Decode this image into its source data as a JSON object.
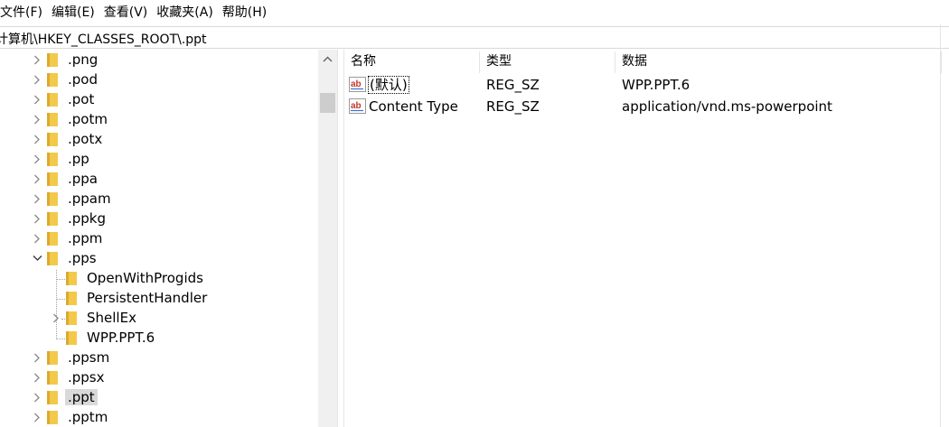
{
  "menu": {
    "file": "文件(F)",
    "edit": "编辑(E)",
    "view": "查看(V)",
    "favorites": "收藏夹(A)",
    "help": "帮助(H)"
  },
  "address": {
    "path": "计算机\\HKEY_CLASSES_ROOT\\.ppt"
  },
  "tree": {
    "items": [
      {
        "label": ".png",
        "state": "collapsed"
      },
      {
        "label": ".pod",
        "state": "collapsed"
      },
      {
        "label": ".pot",
        "state": "collapsed"
      },
      {
        "label": ".potm",
        "state": "collapsed"
      },
      {
        "label": ".potx",
        "state": "collapsed"
      },
      {
        "label": ".pp",
        "state": "collapsed"
      },
      {
        "label": ".ppa",
        "state": "collapsed"
      },
      {
        "label": ".ppam",
        "state": "collapsed"
      },
      {
        "label": ".ppkg",
        "state": "collapsed"
      },
      {
        "label": ".ppm",
        "state": "collapsed"
      },
      {
        "label": ".pps",
        "state": "expanded"
      },
      {
        "label": "OpenWithProgids",
        "state": "leaf"
      },
      {
        "label": "PersistentHandler",
        "state": "leaf"
      },
      {
        "label": "ShellEx",
        "state": "collapsed"
      },
      {
        "label": "WPP.PPT.6",
        "state": "leaf"
      },
      {
        "label": ".ppsm",
        "state": "collapsed"
      },
      {
        "label": ".ppsx",
        "state": "collapsed"
      },
      {
        "label": ".ppt",
        "state": "collapsed",
        "selected": true
      },
      {
        "label": ".pptm",
        "state": "collapsed"
      }
    ]
  },
  "list": {
    "headers": {
      "name": "名称",
      "type": "类型",
      "data": "数据"
    },
    "rows": [
      {
        "name": "(默认)",
        "type": "REG_SZ",
        "data": "WPP.PPT.6",
        "icon": "string-value-icon"
      },
      {
        "name": "Content Type",
        "type": "REG_SZ",
        "data": "application/vnd.ms-powerpoint",
        "icon": "string-value-icon"
      }
    ]
  },
  "colors": {
    "folder": "#f3c94b",
    "folder_dark": "#dcaa2c",
    "selection": "#d9d9d9",
    "ab_red": "#c0392b"
  }
}
